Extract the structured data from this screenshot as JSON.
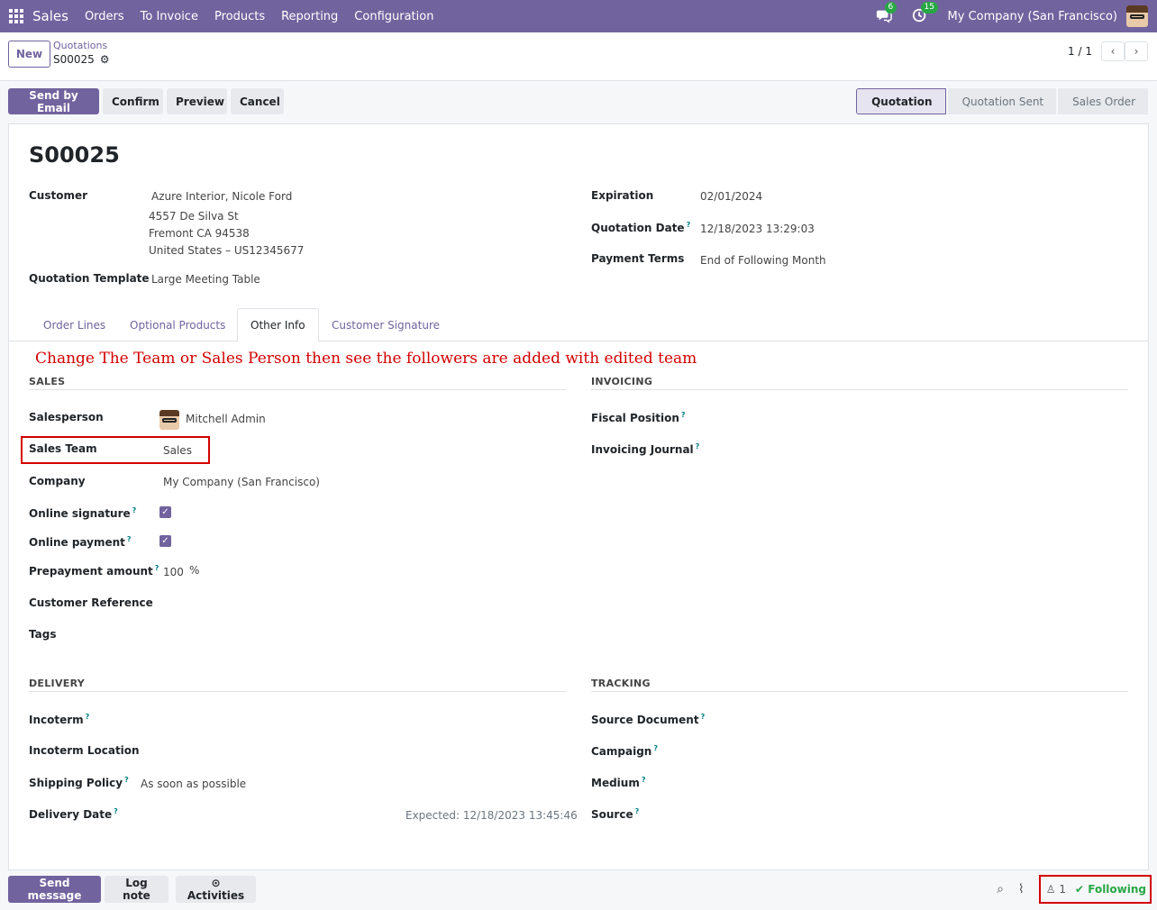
{
  "navbar": {
    "brand": "Sales",
    "menu": [
      "Orders",
      "To Invoice",
      "Products",
      "Reporting",
      "Configuration"
    ],
    "messages_badge": "6",
    "activities_badge": "15",
    "company": "My Company (San Francisco)"
  },
  "control_panel": {
    "new_label": "New",
    "breadcrumb_parent": "Quotations",
    "breadcrumb_current": "S00025",
    "pager": "1 / 1"
  },
  "actions": {
    "send_email": "Send by Email",
    "confirm": "Confirm",
    "preview": "Preview",
    "cancel": "Cancel"
  },
  "stages": [
    "Quotation",
    "Quotation Sent",
    "Sales Order"
  ],
  "record": {
    "title": "S00025",
    "customer_label": "Customer",
    "customer_name": "Azure Interior, Nicole Ford",
    "customer_addr1": "4557 De Silva St",
    "customer_addr2": "Fremont CA 94538",
    "customer_addr3": "United States – US12345677",
    "template_label": "Quotation Template",
    "template_value": "Large Meeting Table",
    "expiration_label": "Expiration",
    "expiration_value": "02/01/2024",
    "quotation_date_label": "Quotation Date",
    "quotation_date_value": "12/18/2023 13:29:03",
    "payment_terms_label": "Payment Terms",
    "payment_terms_value": "End of Following Month"
  },
  "tabs": [
    "Order Lines",
    "Optional Products",
    "Other Info",
    "Customer Signature"
  ],
  "note": "Change The Team or Sales Person then see the followers are added with edited team",
  "sales": {
    "title": "SALES",
    "salesperson_label": "Salesperson",
    "salesperson_value": "Mitchell Admin",
    "team_label": "Sales Team",
    "team_value": "Sales",
    "company_label": "Company",
    "company_value": "My Company (San Francisco)",
    "online_signature_label": "Online signature",
    "online_payment_label": "Online payment",
    "prepayment_label": "Prepayment amount",
    "prepayment_value": "100",
    "prepayment_unit": "%",
    "customer_ref_label": "Customer Reference",
    "tags_label": "Tags"
  },
  "invoicing": {
    "title": "INVOICING",
    "fiscal_label": "Fiscal Position",
    "journal_label": "Invoicing Journal"
  },
  "delivery": {
    "title": "DELIVERY",
    "incoterm_label": "Incoterm",
    "incoterm_location_label": "Incoterm Location",
    "shipping_policy_label": "Shipping Policy",
    "shipping_policy_value": "As soon as possible",
    "delivery_date_label": "Delivery Date",
    "expected_value": "Expected: 12/18/2023 13:45:46"
  },
  "tracking": {
    "title": "TRACKING",
    "source_doc_label": "Source Document",
    "campaign_label": "Campaign",
    "medium_label": "Medium",
    "source_label": "Source"
  },
  "chatter": {
    "send_message": "Send message",
    "log_note": "Log note",
    "activities": "Activities",
    "followers_count": "1",
    "following": "Following"
  }
}
